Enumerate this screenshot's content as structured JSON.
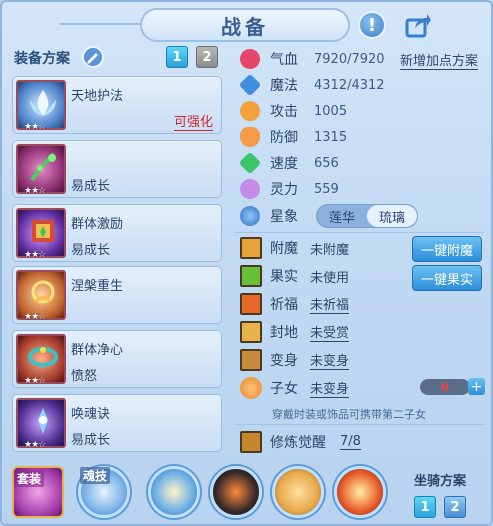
{
  "window": {
    "title": "战备"
  },
  "icons": {
    "help": "help-icon",
    "share": "share-icon"
  },
  "equipment": {
    "label": "装备方案",
    "tabs": [
      "1",
      "2"
    ],
    "cards": [
      {
        "name": "天地护法",
        "sub": "",
        "flag": "可强化",
        "stars": "★★☆"
      },
      {
        "name": "",
        "sub": "易成长",
        "flag": "",
        "stars": "★★☆"
      },
      {
        "name": "群体激励",
        "sub": "易成长",
        "flag": "",
        "stars": "★★☆"
      },
      {
        "name": "涅槃重生",
        "sub": "",
        "flag": "",
        "stars": "★★☆"
      },
      {
        "name": "群体净心",
        "sub": "愤怒",
        "flag": "",
        "stars": "★★☆"
      },
      {
        "name": "唤魂诀",
        "sub": "易成长",
        "flag": "",
        "stars": "★★☆"
      }
    ]
  },
  "stats": {
    "add_point": "新增加点方案",
    "items": [
      {
        "label": "气血",
        "value": "7920/7920",
        "color": "#e8456a"
      },
      {
        "label": "魔法",
        "value": "4312/4312",
        "color": "#3f8fe0"
      },
      {
        "label": "攻击",
        "value": "1005",
        "color": "#f2a23a"
      },
      {
        "label": "防御",
        "value": "1315",
        "color": "#f29c4a"
      },
      {
        "label": "速度",
        "value": "656",
        "color": "#3cc468"
      },
      {
        "label": "灵力",
        "value": "559",
        "color": "#c48be8"
      }
    ]
  },
  "xingxiang": {
    "label": "星象",
    "options": [
      "莲华",
      "琉璃"
    ],
    "selected": "琉璃"
  },
  "attributes": [
    {
      "label": "附魔",
      "value": "未附魔",
      "underline": false
    },
    {
      "label": "果实",
      "value": "未使用",
      "underline": false
    },
    {
      "label": "祈福",
      "value": "未祈福",
      "underline": true
    },
    {
      "label": "封地",
      "value": "未受赏",
      "underline": true
    },
    {
      "label": "变身",
      "value": "未变身",
      "underline": true
    },
    {
      "label": "子女",
      "value": "未变身",
      "underline": true
    }
  ],
  "buttons": {
    "enchant": "一键附魔",
    "fruit": "一键果实"
  },
  "children": {
    "count": "0",
    "note": "穿戴时装或饰品可携带第二子女"
  },
  "cultivation": {
    "label": "修炼觉醒",
    "value": "7/8"
  },
  "bottom": {
    "outfit": "套装",
    "soul_skill": "魂技",
    "mount_label": "坐骑方案",
    "mount_tabs": [
      "1",
      "2"
    ]
  },
  "colors": {
    "accent": "#2d8ed6",
    "warning": "#d8262c"
  }
}
